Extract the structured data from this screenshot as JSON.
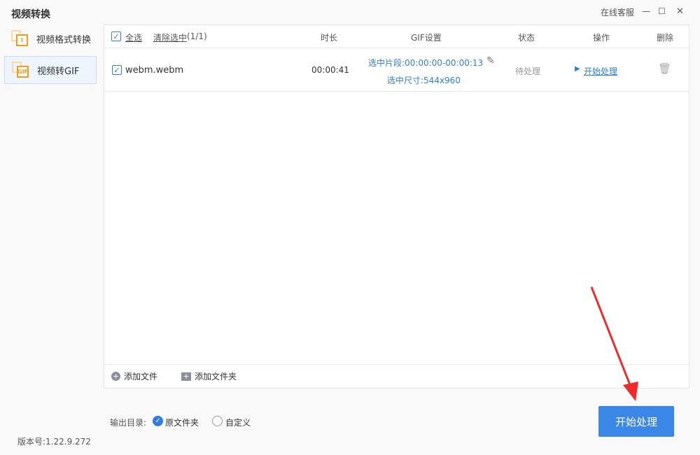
{
  "title": "视频转换",
  "window": {
    "support": "在线客服",
    "minimize": "—",
    "maximize": "☐",
    "close": "✕"
  },
  "sidebar": {
    "items": [
      {
        "label": "视频格式转换",
        "icon": "⇕"
      },
      {
        "label": "视频转GIF",
        "icon": "GIF"
      }
    ]
  },
  "table": {
    "select_all": "全选",
    "clear": "清除选中",
    "count": "(1/1)",
    "headers": {
      "duration": "时长",
      "gif": "GIF设置",
      "status": "状态",
      "action": "操作",
      "delete": "删除"
    },
    "rows": [
      {
        "name": "webm.webm",
        "duration": "00:00:41",
        "segment": "选中片段:00:00:00-00:00:13",
        "size": "选中尺寸:544x960",
        "status": "待处理",
        "action": "开始处理"
      }
    ]
  },
  "footer": {
    "add_file": "添加文件",
    "add_folder": "添加文件夹"
  },
  "output": {
    "label": "输出目录:",
    "original": "原文件夹",
    "custom": "自定义"
  },
  "start_button": "开始处理",
  "version": "版本号:1.22.9.272",
  "colors": {
    "accent": "#3a87e8",
    "annotation": "#f02a2a"
  }
}
